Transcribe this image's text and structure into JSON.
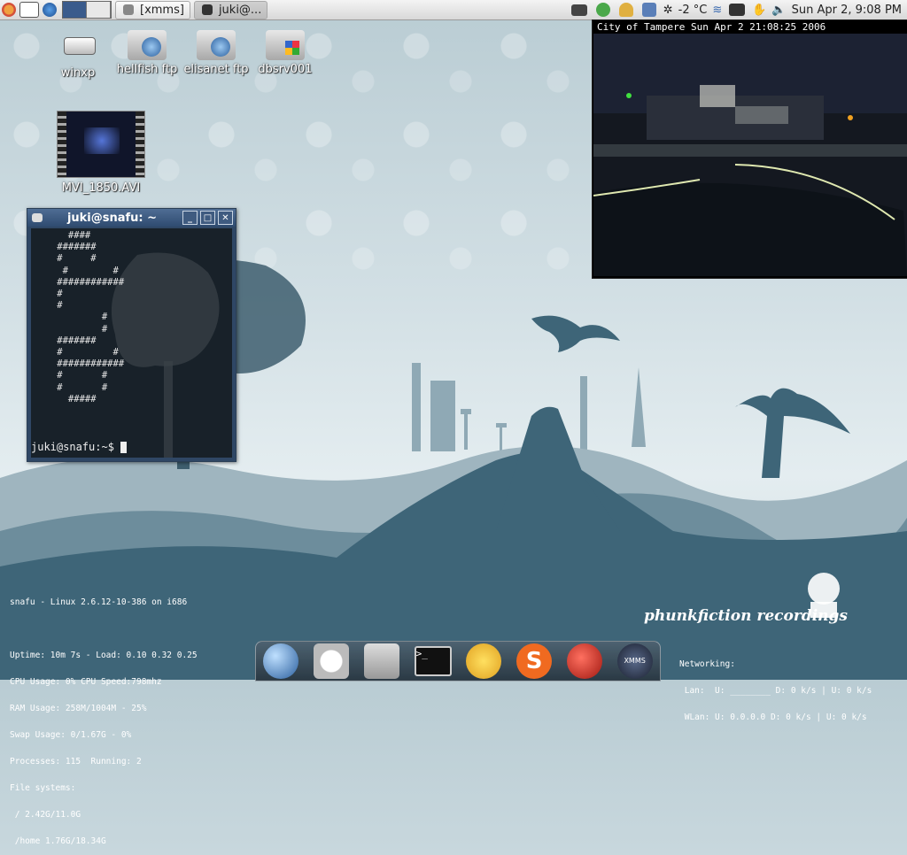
{
  "panel": {
    "tasks": [
      {
        "label": "[xmms]",
        "active": false
      },
      {
        "label": "juki@...",
        "active": true
      }
    ],
    "temperature": "-2 °C",
    "clock": "Sun Apr  2,  9:08 PM"
  },
  "desktop_icons": [
    {
      "label": "winxp",
      "icon": "drive-icon"
    },
    {
      "label": "hellfish ftp",
      "icon": "network-folder-icon"
    },
    {
      "label": "elisanet ftp",
      "icon": "network-folder-icon"
    },
    {
      "label": "dbsrv001",
      "icon": "windows-share-folder-icon"
    },
    {
      "label": "MVI_1850.AVI",
      "icon": "video-file-icon"
    }
  ],
  "terminal": {
    "title": "juki@snafu: ~",
    "ascii_art": "      ####\n    #######\n    #     #\n     #        #\n    ############\n    #\n    #\n            #\n            #\n    #######\n    #         #\n    ############\n    #       #\n    #       #\n      #####",
    "prompt": "juki@snafu:~$ "
  },
  "webcam": {
    "caption": "City of Tampere  Sun Apr  2  21:08:25  2006"
  },
  "sysinfo": {
    "lines": [
      "snafu - Linux 2.6.12-10-386 on i686",
      "",
      "Uptime: 10m 7s - Load: 0.10 0.32 0.25",
      "CPU Usage: 0% CPU Speed:798mhz",
      "RAM Usage: 258M/1004M - 25%",
      "Swap Usage: 0/1.67G - 0%",
      "Processes: 115  Running: 2",
      "File systems:",
      " / 2.42G/11.0G",
      " /home 1.76G/18.34G"
    ]
  },
  "network": {
    "lines": [
      "Networking:",
      " Lan:  U: ________ D: 0 k/s | U: 0 k/s",
      " WLan: U: 0.0.0.0 D: 0 k/s | U: 0 k/s"
    ]
  },
  "wallpaper_logo": "phunkfiction recordings",
  "dock": {
    "items": [
      "globe-browser-icon",
      "mail-clock-icon",
      "home-folder-icon",
      "terminal-icon",
      "gaim-smiley-icon",
      "skype-icon",
      "apple-icon",
      "xmms-icon"
    ],
    "xmms_label": "XMMS"
  },
  "colors": {
    "terminal_title": "#3a5a83",
    "landscape": "#3e6578"
  }
}
